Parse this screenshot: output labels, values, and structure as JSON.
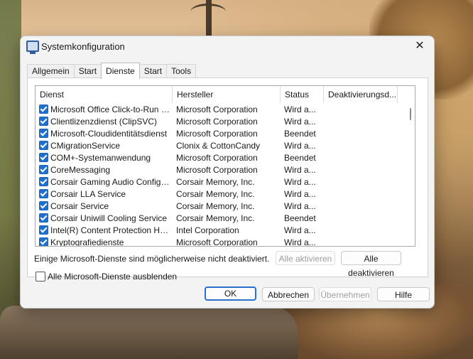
{
  "window": {
    "title": "Systemkonfiguration"
  },
  "tabs": [
    {
      "label": "Allgemein"
    },
    {
      "label": "Start"
    },
    {
      "label": "Dienste"
    },
    {
      "label": "Start"
    },
    {
      "label": "Tools"
    }
  ],
  "columns": {
    "service": "Dienst",
    "manufacturer": "Hersteller",
    "status": "Status",
    "disabled": "Deaktivierungsd..."
  },
  "rows": [
    {
      "service": "Microsoft Office Click-to-Run Ser...",
      "manufacturer": "Microsoft Corporation",
      "status": "Wird a..."
    },
    {
      "service": "Clientlizenzdienst (ClipSVC)",
      "manufacturer": "Microsoft Corporation",
      "status": "Wird a..."
    },
    {
      "service": "Microsoft-Cloudidentitätsdienst",
      "manufacturer": "Microsoft Corporation",
      "status": "Beendet"
    },
    {
      "service": "CMigrationService",
      "manufacturer": "Clonix & CottonCandy",
      "status": "Wird a..."
    },
    {
      "service": "COM+-Systemanwendung",
      "manufacturer": "Microsoft Corporation",
      "status": "Beendet"
    },
    {
      "service": "CoreMessaging",
      "manufacturer": "Microsoft Corporation",
      "status": "Wird a..."
    },
    {
      "service": "Corsair Gaming Audio Configurat...",
      "manufacturer": "Corsair Memory, Inc.",
      "status": "Wird a..."
    },
    {
      "service": "Corsair LLA Service",
      "manufacturer": "Corsair Memory, Inc.",
      "status": "Wird a..."
    },
    {
      "service": "Corsair Service",
      "manufacturer": "Corsair Memory, Inc.",
      "status": "Wird a..."
    },
    {
      "service": "Corsair Uniwill Cooling Service",
      "manufacturer": "Corsair Memory, Inc.",
      "status": "Beendet"
    },
    {
      "service": "Intel(R) Content Protection HDC...",
      "manufacturer": "Intel Corporation",
      "status": "Wird a..."
    },
    {
      "service": "Kryptografiedienste",
      "manufacturer": "Microsoft Corporation",
      "status": "Wird a..."
    }
  ],
  "info_text": "Einige Microsoft-Dienste sind möglicherweise nicht deaktiviert.",
  "enable_all": "Alle aktivieren",
  "disable_all": "Alle deaktivieren",
  "hide_ms_label": "Alle Microsoft-Dienste ausblenden",
  "buttons": {
    "ok": "OK",
    "cancel": "Abbrechen",
    "apply": "Übernehmen",
    "help": "Hilfe"
  },
  "colors": {
    "accent": "#1f6fcc"
  }
}
